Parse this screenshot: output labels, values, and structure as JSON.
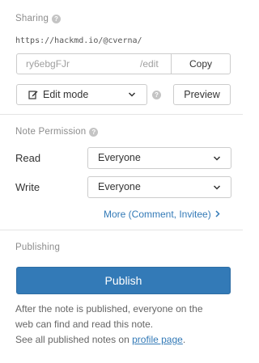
{
  "sharing": {
    "title": "Sharing",
    "url": "https://hackmd.io/@cverna/",
    "slug": "ry6ebgFJr",
    "suffix": "/edit",
    "copy_label": "Copy",
    "mode_label": "Edit mode",
    "preview_label": "Preview"
  },
  "permission": {
    "title": "Note Permission",
    "read_label": "Read",
    "read_value": "Everyone",
    "write_label": "Write",
    "write_value": "Everyone",
    "more_label": "More (Comment, Invitee)"
  },
  "publishing": {
    "title": "Publishing",
    "button_label": "Publish",
    "line1": "After the note is published, everyone on the",
    "line2": "web can find and read this note.",
    "line3_prefix": "See all published notes on ",
    "link_label": "profile page",
    "line3_suffix": "."
  },
  "colors": {
    "accent": "#337ab7",
    "muted": "#8c8c8c",
    "border": "#cccccc"
  },
  "icons": [
    "help-icon",
    "pencil-icon",
    "chevron-down-icon",
    "chevron-right-icon"
  ]
}
